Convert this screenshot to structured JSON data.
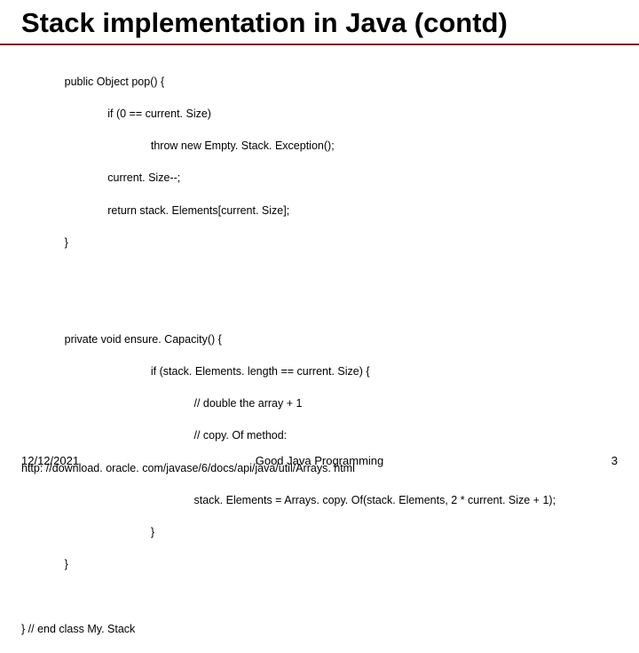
{
  "title": "Stack implementation in Java (contd)",
  "code": {
    "l1": "              public Object pop() {",
    "l2": "                            if (0 == current. Size)",
    "l3": "                                          throw new Empty. Stack. Exception();",
    "l4": "                            current. Size--;",
    "l5": "                            return stack. Elements[current. Size];",
    "l6": "              }",
    "l7": "",
    "l8": "",
    "l9": "              private void ensure. Capacity() {",
    "l10": "                                          if (stack. Elements. length == current. Size) {",
    "l11": "                                                        // double the array + 1",
    "l12": "                                                        // copy. Of method:",
    "l13": "http: //download. oracle. com/javase/6/docs/api/java/util/Arrays. html",
    "l14": "                                                        stack. Elements = Arrays. copy. Of(stack. Elements, 2 * current. Size + 1);",
    "l15": "                                          }",
    "l16": "              }",
    "l17": "",
    "l18": "} // end class My. Stack"
  },
  "footer": {
    "date": "12/12/2021",
    "center": "Good Java Programming",
    "page": "3"
  }
}
